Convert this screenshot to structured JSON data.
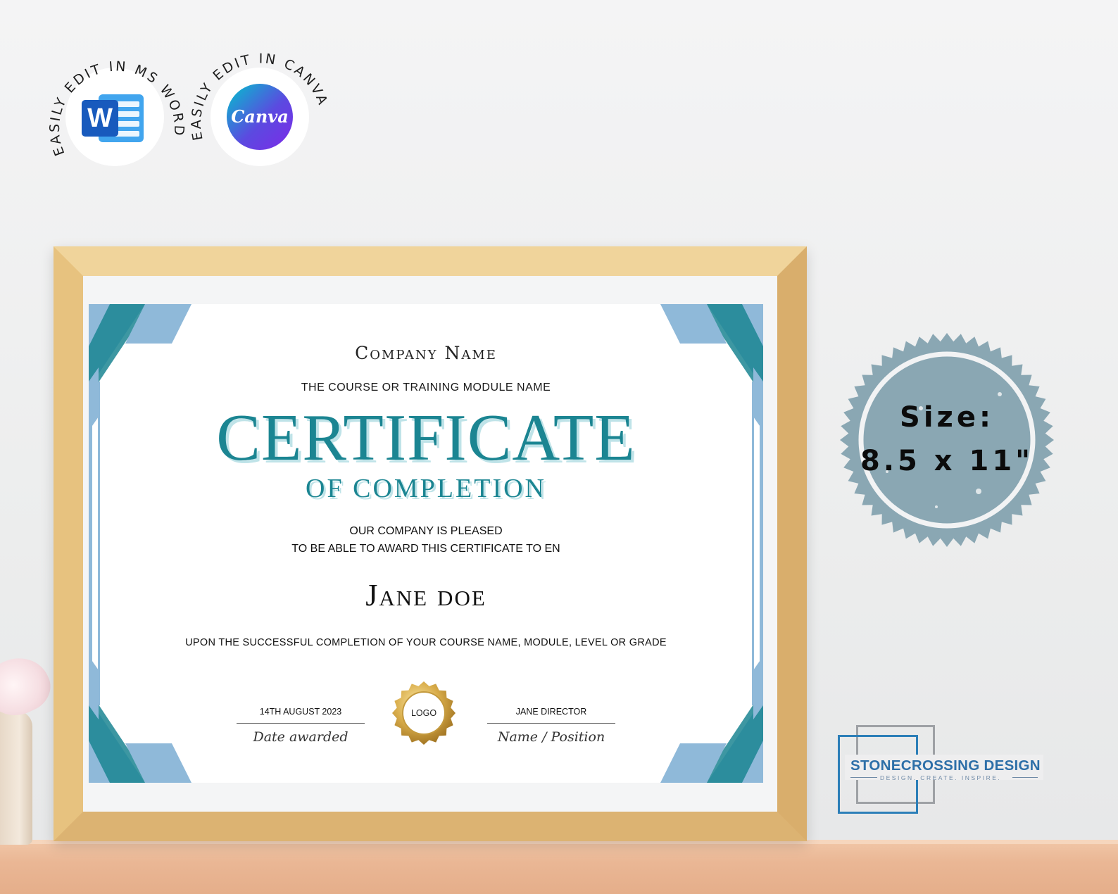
{
  "badges": {
    "word": {
      "arc_text": "EASILY EDIT IN MS WORD",
      "icon": "word-icon",
      "icon_letter": "W",
      "color": "#185abd"
    },
    "canva": {
      "arc_text": "EASILY EDIT IN CANVA",
      "icon": "canva-icon",
      "logo_text": "Canva",
      "color": "#7d2ae8"
    }
  },
  "certificate": {
    "company": "Company Name",
    "course": "THE COURSE OR TRAINING MODULE NAME",
    "title": "CERTIFICATE",
    "subtitle": "OF COMPLETION",
    "pleased_line1": "OUR COMPANY IS PLEASED",
    "pleased_line2": "TO BE ABLE TO AWARD THIS CERTIFICATE TO EN",
    "recipient": "Jane doe",
    "completion": "UPON THE SUCCESSFUL COMPLETION OF YOUR COURSE NAME, MODULE, LEVEL OR GRADE",
    "date_value": "14TH AUGUST 2023",
    "date_caption": "Date awarded",
    "seal_label": "LOGO",
    "signer_value": "JANE DIRECTOR",
    "signer_caption": "Name / Position",
    "accent_color": "#1b8592",
    "border_light": "#8fb9d9",
    "border_dark": "#1b8592"
  },
  "stamp": {
    "line1": "Size:",
    "line2": "8.5 x 11\"",
    "color": "#8aa7b3"
  },
  "brand": {
    "name": "STONECROSSING DESIGN",
    "tagline": "DESIGN. CREATE. INSPIRE.",
    "color": "#2d6fa8"
  }
}
